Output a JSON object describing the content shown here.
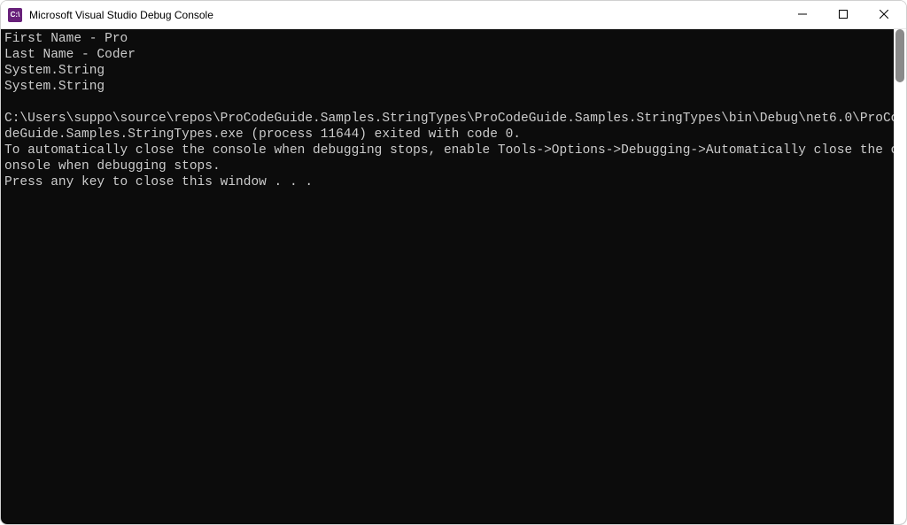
{
  "titlebar": {
    "icon_label": "C:\\",
    "title": "Microsoft Visual Studio Debug Console"
  },
  "console": {
    "lines": [
      "First Name - Pro",
      "Last Name - Coder",
      "System.String",
      "System.String",
      "",
      "C:\\Users\\suppo\\source\\repos\\ProCodeGuide.Samples.StringTypes\\ProCodeGuide.Samples.StringTypes\\bin\\Debug\\net6.0\\ProCodeGuide.Samples.StringTypes.exe (process 11644) exited with code 0.",
      "To automatically close the console when debugging stops, enable Tools->Options->Debugging->Automatically close the console when debugging stops.",
      "Press any key to close this window . . ."
    ]
  }
}
